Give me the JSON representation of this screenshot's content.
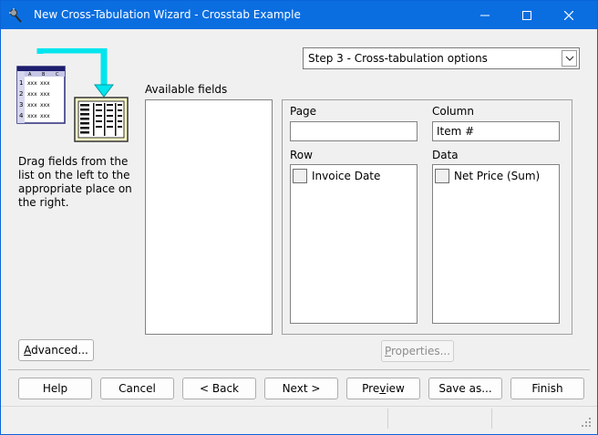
{
  "window": {
    "title": "New Cross-Tabulation Wizard - Crosstab Example"
  },
  "step_dropdown": {
    "selected": "Step 3 - Cross-tabulation options"
  },
  "wizard_image": {
    "sheet_columns": [
      "A",
      "B",
      "C"
    ],
    "sheet_rows": [
      "1",
      "2",
      "3",
      "4"
    ],
    "cell_text": "xxx"
  },
  "instructions": "Drag fields from the list on the left to the appropriate place on the right.",
  "available_fields": {
    "label": "Available fields",
    "items": []
  },
  "zones": {
    "page": {
      "label": "Page",
      "value": ""
    },
    "column": {
      "label": "Column",
      "value": "Item #"
    },
    "row": {
      "label": "Row",
      "items": [
        "Invoice Date"
      ]
    },
    "data": {
      "label": "Data",
      "items": [
        "Net Price (Sum)"
      ]
    }
  },
  "buttons": {
    "advanced": {
      "mnemonic": "A",
      "rest": "dvanced..."
    },
    "properties": {
      "mnemonic": "P",
      "rest": "roperties..."
    },
    "help": "Help",
    "cancel": "Cancel",
    "back": "< Back",
    "next": "Next >",
    "preview": {
      "before": "Pre",
      "mnemonic": "v",
      "after": "iew"
    },
    "save_as": "Save as...",
    "finish": "Finish"
  }
}
